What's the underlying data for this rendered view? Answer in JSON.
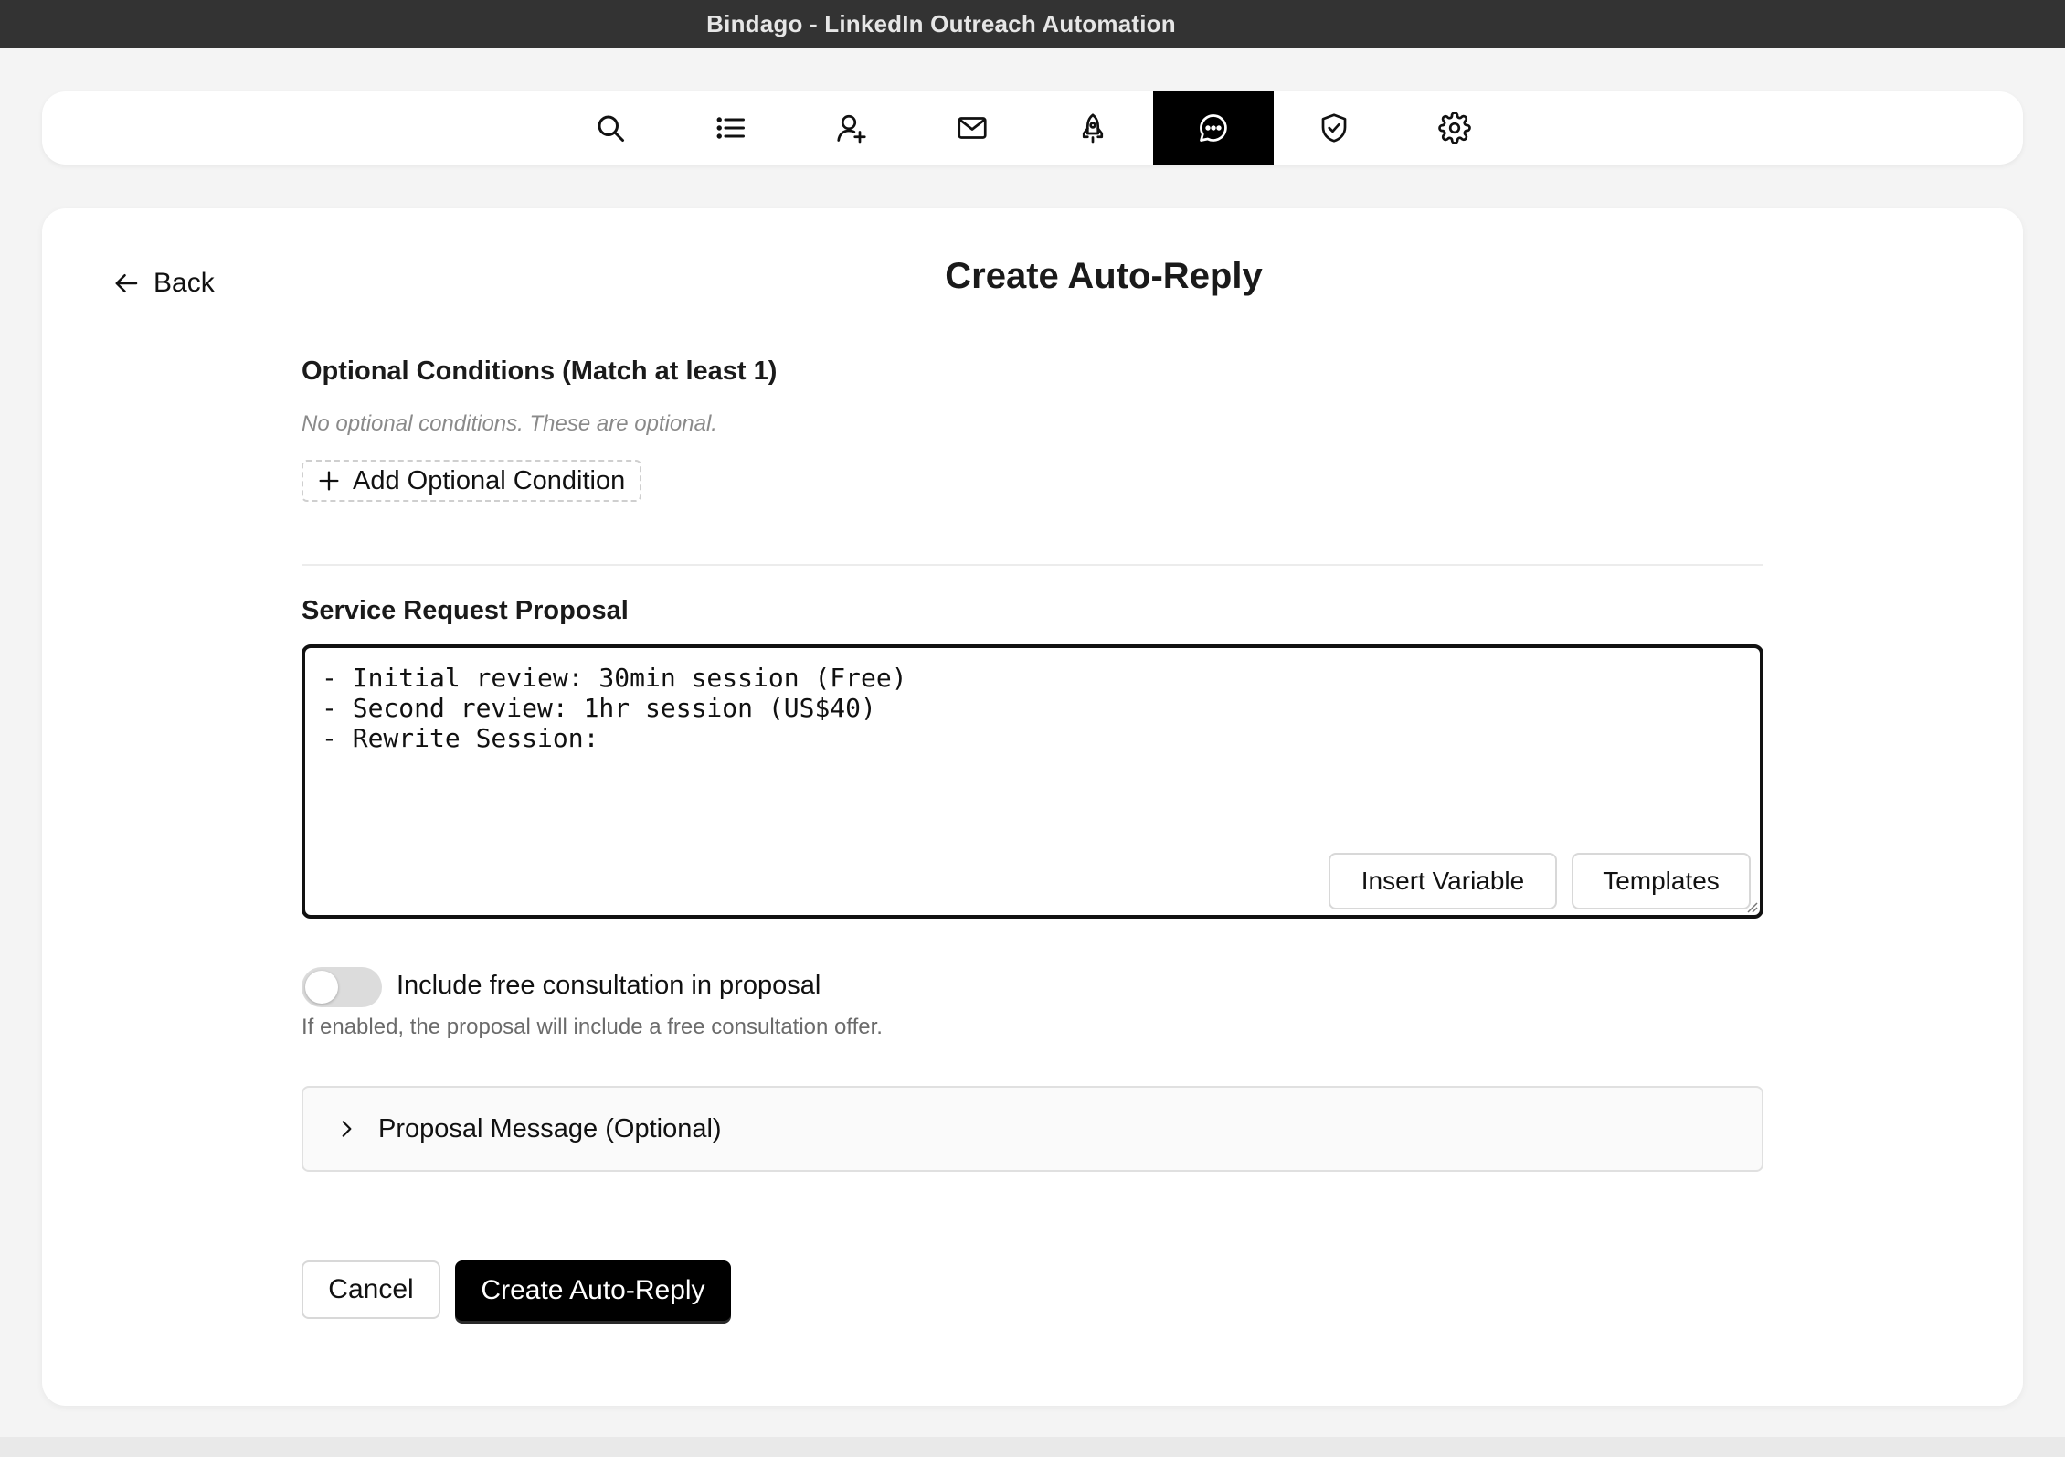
{
  "window": {
    "title": "Bindago - LinkedIn Outreach Automation"
  },
  "nav": {
    "items": [
      {
        "icon": "search-icon",
        "active": false
      },
      {
        "icon": "list-icon",
        "active": false
      },
      {
        "icon": "user-add-icon",
        "active": false
      },
      {
        "icon": "mail-icon",
        "active": false
      },
      {
        "icon": "rocket-icon",
        "active": false
      },
      {
        "icon": "chat-bubble-icon",
        "active": true
      },
      {
        "icon": "shield-check-icon",
        "active": false
      },
      {
        "icon": "gear-icon",
        "active": false
      }
    ]
  },
  "page": {
    "back_label": "Back",
    "title": "Create Auto-Reply"
  },
  "optional_conditions": {
    "heading": "Optional Conditions (Match at least 1)",
    "empty_text": "No optional conditions. These are optional.",
    "add_label": "Add Optional Condition"
  },
  "proposal": {
    "heading": "Service Request Proposal",
    "value": "- Initial review: 30min session (Free)\n- Second review: 1hr session (US$40)\n- Rewrite Session:",
    "insert_variable_label": "Insert Variable",
    "templates_label": "Templates"
  },
  "free_consultation": {
    "label": "Include free consultation in proposal",
    "enabled": false,
    "help": "If enabled, the proposal will include a free consultation offer."
  },
  "proposal_message": {
    "label": "Proposal Message (Optional)",
    "expanded": false
  },
  "actions": {
    "cancel_label": "Cancel",
    "create_label": "Create Auto-Reply"
  }
}
